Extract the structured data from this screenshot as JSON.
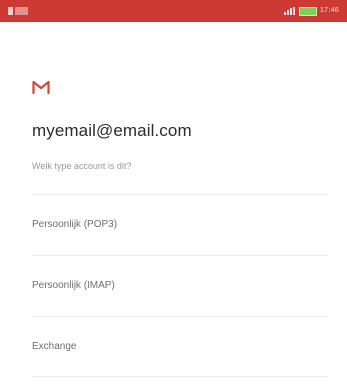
{
  "status_bar": {
    "color": "#cc3a33",
    "icons": [
      "signal-icon",
      "battery-icon"
    ],
    "clock": "17:46"
  },
  "header": {
    "logo_icon": "gmail-m-icon",
    "logo_color": "#d44638",
    "email": "myemail@email.com",
    "question": "Welk type account is dit?"
  },
  "account_types": [
    {
      "label": "Persoonlijk (POP3)"
    },
    {
      "label": "Persoonlijk (IMAP)"
    },
    {
      "label": "Exchange"
    }
  ]
}
